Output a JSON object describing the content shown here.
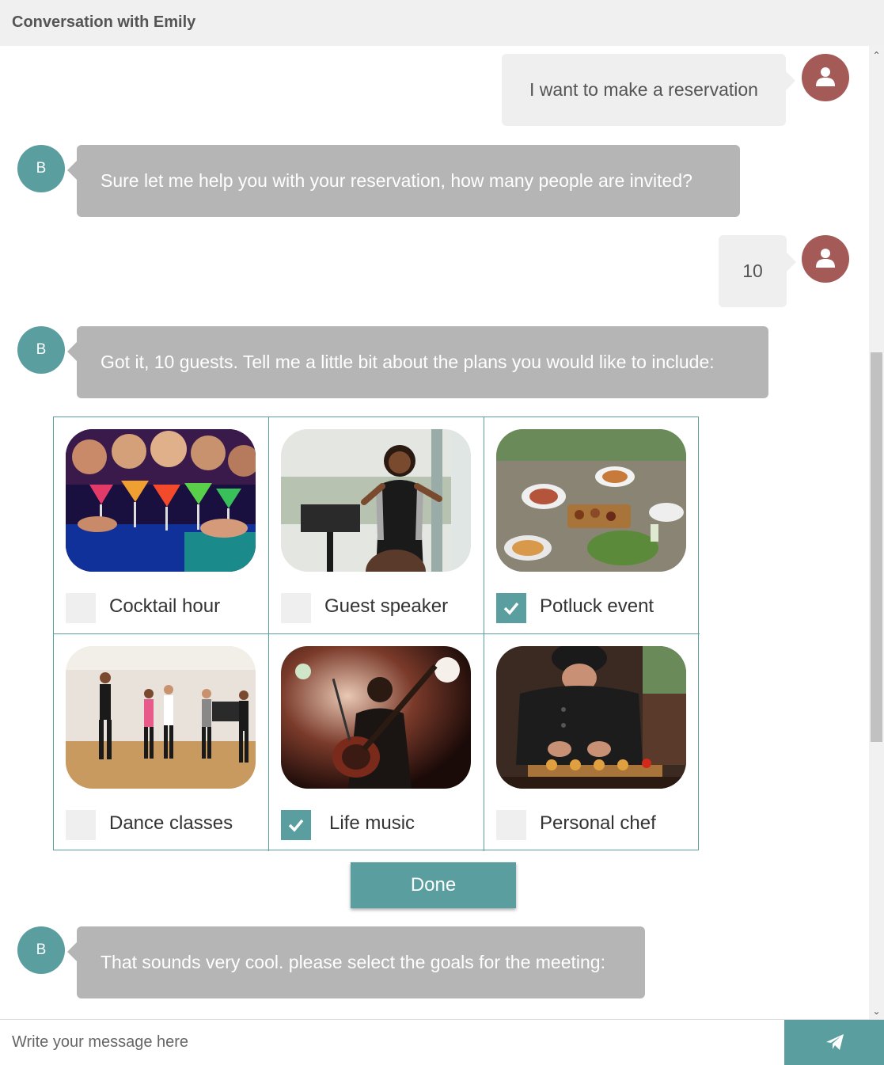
{
  "header": {
    "title": "Conversation with Emily"
  },
  "messages": [
    {
      "from": "user",
      "text": "I want to make a reservation"
    },
    {
      "from": "bot",
      "avatar_letter": "B",
      "text": "Sure let me help you with your reservation, how many people are invited?"
    },
    {
      "from": "user",
      "text": "10"
    },
    {
      "from": "bot",
      "avatar_letter": "B",
      "text": "Got it, 10 guests. Tell me a little bit about the plans you would like to include:"
    },
    {
      "from": "bot",
      "avatar_letter": "B",
      "text": "That sounds very cool. please select the goals for the meeting:"
    }
  ],
  "options": [
    {
      "label": "Cocktail hour",
      "checked": false,
      "image": "party-cocktails-photo"
    },
    {
      "label": "Guest speaker",
      "checked": false,
      "image": "speaker-podium-photo"
    },
    {
      "label": "Potluck event",
      "checked": true,
      "image": "potluck-table-photo"
    },
    {
      "label": "Dance classes",
      "checked": false,
      "image": "dance-class-photo"
    },
    {
      "label": "Life music",
      "checked": true,
      "image": "guitarist-concert-photo"
    },
    {
      "label": "Personal chef",
      "checked": false,
      "image": "chef-plating-photo"
    }
  ],
  "done_label": "Done",
  "composer": {
    "placeholder": "Write your message here",
    "send_icon": "paper-plane-icon"
  },
  "colors": {
    "accent": "#5a9ea0",
    "user_avatar": "#a45a57",
    "bot_bubble": "#b5b5b5",
    "user_bubble": "#efefef"
  }
}
